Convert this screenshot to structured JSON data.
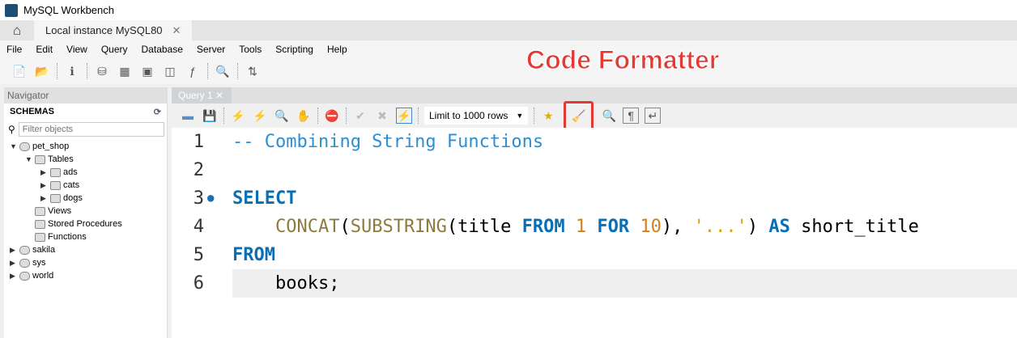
{
  "window": {
    "title": "MySQL Workbench"
  },
  "tabs": [
    {
      "label": "Local instance MySQL80"
    }
  ],
  "menu": [
    "File",
    "Edit",
    "View",
    "Query",
    "Database",
    "Server",
    "Tools",
    "Scripting",
    "Help"
  ],
  "navigator": {
    "title": "Navigator",
    "section": "SCHEMAS",
    "filter_placeholder": "Filter objects",
    "tree": [
      {
        "label": "pet_shop",
        "expanded": true
      },
      {
        "label": "Tables"
      },
      {
        "label": "ads"
      },
      {
        "label": "cats"
      },
      {
        "label": "dogs"
      },
      {
        "label": "Views"
      },
      {
        "label": "Stored Procedures"
      },
      {
        "label": "Functions"
      },
      {
        "label": "sakila"
      },
      {
        "label": "sys"
      },
      {
        "label": "world"
      }
    ]
  },
  "query_tab": {
    "label": "Query 1"
  },
  "editor_toolbar": {
    "limit": "Limit to 1000 rows"
  },
  "annotation": "Code Formatter",
  "editor": {
    "line_numbers": [
      "1",
      "2",
      "3",
      "4",
      "5",
      "6"
    ],
    "l1": "-- Combining String Functions",
    "l3": "SELECT",
    "l4": {
      "indent": "    ",
      "f1": "CONCAT",
      "p1": "(",
      "f2": "SUBSTRING",
      "p2": "(title ",
      "k1": "FROM",
      "s1": " ",
      "n1": "1",
      "s2": " ",
      "k2": "FOR",
      "s3": " ",
      "n2": "10",
      "p3": "), ",
      "str": "'...'",
      "p4": ") ",
      "k3": "AS",
      "p5": " short_title"
    },
    "l5": "FROM",
    "l6": "    books;"
  }
}
